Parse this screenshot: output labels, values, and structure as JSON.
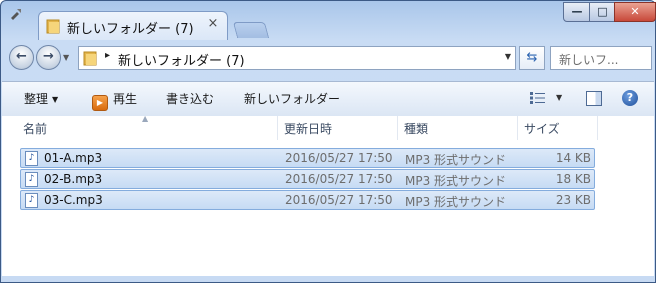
{
  "window": {
    "tab_title": "新しいフォルダー (7)",
    "tab_close": "×",
    "caption_min": "—",
    "caption_max": "□",
    "caption_close": "✕"
  },
  "nav": {
    "back": "←",
    "forward": "→",
    "address_path": "新しいフォルダー (7)",
    "address_sep": "▸",
    "search_placeholder": "新しいフ..."
  },
  "toolbar": {
    "organize": "整理",
    "play": "再生",
    "burn": "書き込む",
    "new_folder": "新しいフォルダー"
  },
  "columns": [
    "名前",
    "更新日時",
    "種類",
    "サイズ"
  ],
  "files": [
    {
      "name": "01-A.mp3",
      "date": "2016/05/27 17:50",
      "type": "MP3 形式サウンド",
      "size": "14 KB"
    },
    {
      "name": "02-B.mp3",
      "date": "2016/05/27 17:50",
      "type": "MP3 形式サウンド",
      "size": "18 KB"
    },
    {
      "name": "03-C.mp3",
      "date": "2016/05/27 17:50",
      "type": "MP3 形式サウンド",
      "size": "23 KB"
    }
  ],
  "colors": {
    "selection": "#c6dbf4",
    "selection_border": "#84acdd",
    "frame": "#c7daf3"
  }
}
